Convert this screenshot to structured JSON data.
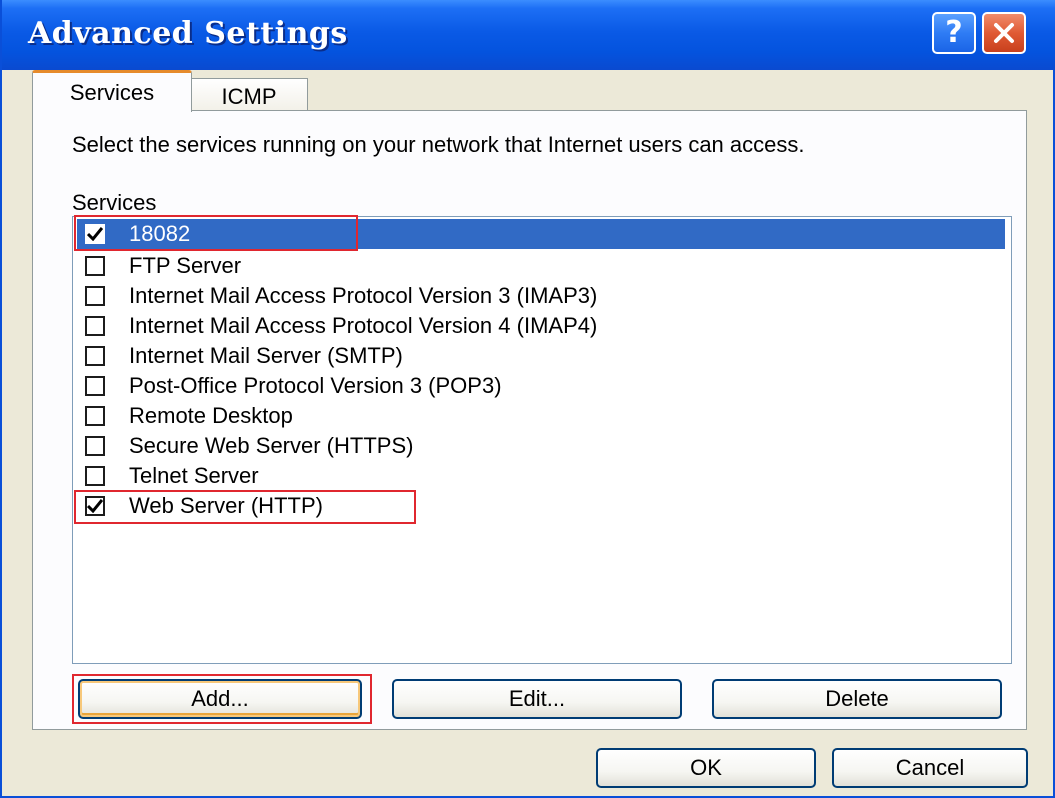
{
  "window": {
    "title": "Advanced Settings",
    "help_glyph": "?",
    "close_icon": "close-icon"
  },
  "tabs": [
    {
      "label": "Services",
      "active": true
    },
    {
      "label": "ICMP",
      "active": false
    }
  ],
  "services_panel": {
    "description": "Select the services running on your network that Internet users can access.",
    "list_label": "Services",
    "items": [
      {
        "label": "18082",
        "checked": true,
        "selected": true
      },
      {
        "label": "FTP Server",
        "checked": false,
        "selected": false
      },
      {
        "label": "Internet Mail Access Protocol Version 3 (IMAP3)",
        "checked": false,
        "selected": false
      },
      {
        "label": "Internet Mail Access Protocol Version 4 (IMAP4)",
        "checked": false,
        "selected": false
      },
      {
        "label": "Internet Mail Server (SMTP)",
        "checked": false,
        "selected": false
      },
      {
        "label": "Post-Office Protocol Version 3 (POP3)",
        "checked": false,
        "selected": false
      },
      {
        "label": "Remote Desktop",
        "checked": false,
        "selected": false
      },
      {
        "label": "Secure Web Server (HTTPS)",
        "checked": false,
        "selected": false
      },
      {
        "label": "Telnet Server",
        "checked": false,
        "selected": false
      },
      {
        "label": "Web Server (HTTP)",
        "checked": true,
        "selected": false
      }
    ],
    "buttons": {
      "add": "Add...",
      "edit": "Edit...",
      "delete": "Delete"
    }
  },
  "dialog_buttons": {
    "ok": "OK",
    "cancel": "Cancel"
  },
  "colors": {
    "titlebar": "#0a5ae6",
    "selection": "#316ac5",
    "highlight_box": "#e0272f",
    "active_tab_accent": "#e68b2c"
  }
}
